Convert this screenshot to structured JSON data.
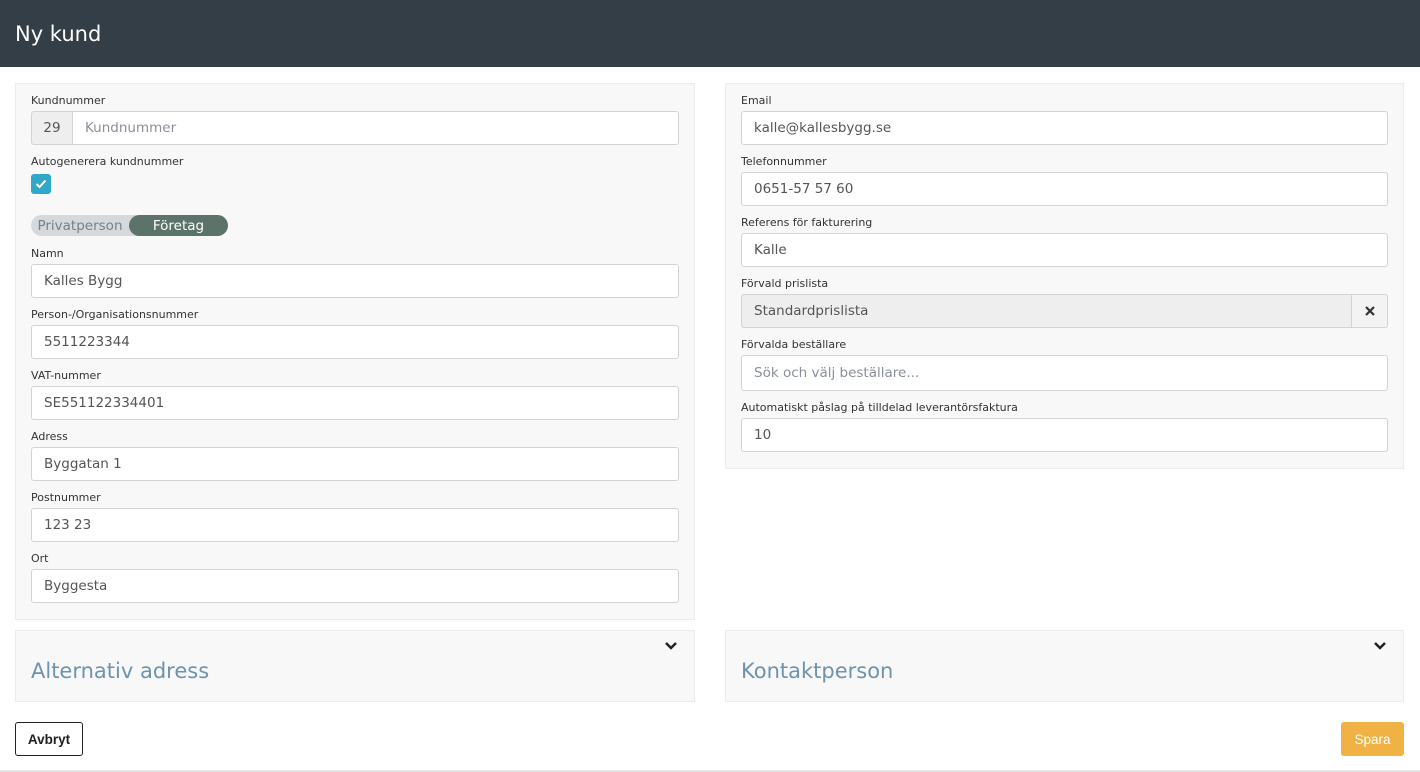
{
  "header": {
    "title": "Ny kund"
  },
  "left": {
    "customer_number": {
      "label": "Kundnummer",
      "prefix": "29",
      "placeholder": "Kundnummer"
    },
    "autogen": {
      "label": "Autogenerera kundnummer",
      "checked": true
    },
    "customer_type": {
      "options": [
        "Privatperson",
        "Företag"
      ],
      "selected": "Företag"
    },
    "name": {
      "label": "Namn",
      "value": "Kalles Bygg"
    },
    "org_number": {
      "label": "Person-/Organisationsnummer",
      "value": "5511223344"
    },
    "vat": {
      "label": "VAT-nummer",
      "value": "SE551122334401"
    },
    "address": {
      "label": "Adress",
      "value": "Byggatan 1"
    },
    "postal_code": {
      "label": "Postnummer",
      "value": "123 23"
    },
    "city": {
      "label": "Ort",
      "value": "Byggesta"
    }
  },
  "right": {
    "email": {
      "label": "Email",
      "value": "kalle@kallesbygg.se"
    },
    "phone": {
      "label": "Telefonnummer",
      "value": "0651-57 57 60"
    },
    "billing_ref": {
      "label": "Referens för fakturering",
      "value": "Kalle"
    },
    "price_list": {
      "label": "Förvald prislista",
      "value": "Standardprislista"
    },
    "orderers": {
      "label": "Förvalda beställare",
      "placeholder": "Sök och välj beställare..."
    },
    "markup": {
      "label": "Automatiskt påslag på tilldelad leverantörsfaktura",
      "value": "10"
    }
  },
  "sections": {
    "alt_address": {
      "title": "Alternativ adress"
    },
    "contact_person": {
      "title": "Kontaktperson"
    }
  },
  "footer": {
    "cancel_label": "Avbryt",
    "save_label": "Spara"
  },
  "colors": {
    "header_bg": "#343e47",
    "accent": "#31a8c7",
    "save": "#f0b244",
    "toggle_active": "#5c7369",
    "section_title": "#6d94ae"
  },
  "icons": {
    "checkbox": "check-icon",
    "clear": "close-icon",
    "expand": "chevron-down-icon"
  }
}
